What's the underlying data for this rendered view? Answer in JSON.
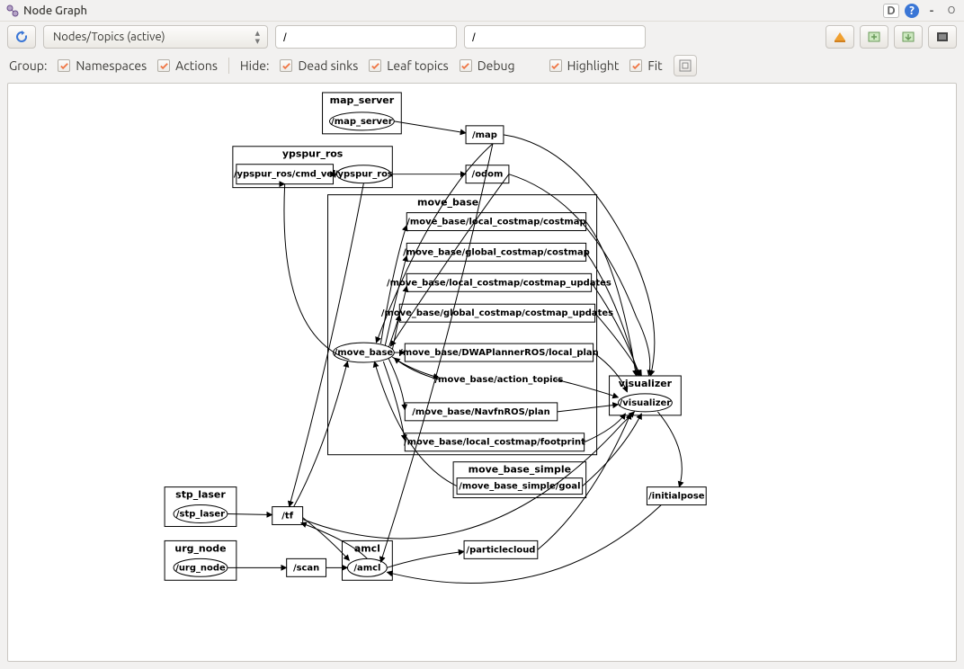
{
  "title": "Node Graph",
  "titlebar_icons": {
    "d": "D",
    "help": "?",
    "min": "-",
    "max": "O"
  },
  "toolbar": {
    "refresh_label": "refresh",
    "select_label": "Nodes/Topics (active)",
    "filter1": "/",
    "filter2": "/"
  },
  "options": {
    "group_label": "Group:",
    "hide_label": "Hide:",
    "namespaces": "Namespaces",
    "actions": "Actions",
    "dead_sinks": "Dead sinks",
    "leaf_topics": "Leaf topics",
    "debug": "Debug",
    "highlight": "Highlight",
    "fit": "Fit"
  },
  "groups": {
    "map_server": {
      "label": "map_server",
      "node": "/map_server"
    },
    "ypspur_ros": {
      "label": "ypspur_ros",
      "cmd_vel": "/ypspur_ros/cmd_vel",
      "node": "/ypspur_ros"
    },
    "move_base": {
      "label": "move_base",
      "node": "/move_base",
      "local_costmap": "/move_base/local_costmap/costmap",
      "global_costmap": "/move_base/global_costmap/costmap",
      "local_updates": "/move_base/local_costmap/costmap_updates",
      "global_updates": "/move_base/global_costmap/costmap_updates",
      "dwa": "/move_base/DWAPlannerROS/local_plan",
      "action": "/move_base/action_topics",
      "navfn": "/move_base/NavfnROS/plan",
      "footprint": "/move_base/local_costmap/footprint"
    },
    "move_base_simple": {
      "label": "move_base_simple",
      "goal": "/move_base_simple/goal"
    },
    "visualizer": {
      "label": "visualizer",
      "node": "/visualizer"
    },
    "stp_laser": {
      "label": "stp_laser",
      "node": "/stp_laser"
    },
    "urg_node": {
      "label": "urg_node",
      "node": "/urg_node"
    },
    "amcl": {
      "label": "amcl",
      "node": "/amcl"
    }
  },
  "topics": {
    "map": "/map",
    "odom": "/odom",
    "tf": "/tf",
    "scan": "/scan",
    "particlecloud": "/particlecloud",
    "initialpose": "/initialpose"
  }
}
